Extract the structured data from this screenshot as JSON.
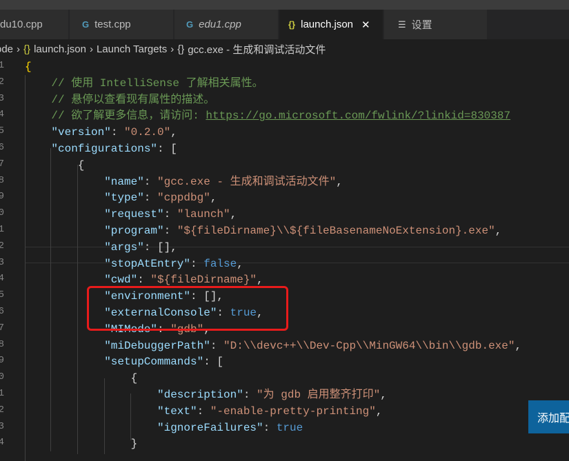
{
  "tabs": [
    {
      "label": "du10.cpp",
      "icon": "cpp-icon"
    },
    {
      "label": "test.cpp",
      "icon": "cpp-icon"
    },
    {
      "label": "edu1.cpp",
      "icon": "cpp-icon"
    },
    {
      "label": "launch.json",
      "icon": "json-icon",
      "active": true
    },
    {
      "label": "设置",
      "icon": "settings-icon"
    }
  ],
  "breadcrumb": [
    "ode",
    "launch.json",
    "Launch Targets",
    "gcc.exe - 生成和调试活动文件"
  ],
  "line_numbers": [
    "1",
    "2",
    "3",
    "4",
    "5",
    "6",
    "7",
    "8",
    "9",
    "0",
    "1",
    "2",
    "3",
    "4",
    "5",
    "6",
    "7",
    "8",
    "9",
    "0",
    "1",
    "2",
    "3",
    "4"
  ],
  "code": [
    [
      [
        0,
        "br",
        "{"
      ]
    ],
    [
      [
        1,
        "c",
        "// 使用 IntelliSense 了解相关属性。"
      ]
    ],
    [
      [
        1,
        "c",
        "// 悬停以查看现有属性的描述。"
      ]
    ],
    [
      [
        1,
        "c",
        "// 欲了解更多信息，请访问: "
      ],
      [
        1,
        "c u",
        "https://go.microsoft.com/fwlink/?linkid=830387"
      ]
    ],
    [
      [
        1,
        "k",
        "\"version\""
      ],
      [
        1,
        "p",
        ": "
      ],
      [
        1,
        "s",
        "\"0.2.0\""
      ],
      [
        1,
        "p",
        ","
      ]
    ],
    [
      [
        1,
        "k",
        "\"configurations\""
      ],
      [
        1,
        "p",
        ": ["
      ]
    ],
    [
      [
        2,
        "p",
        "{"
      ]
    ],
    [
      [
        3,
        "k",
        "\"name\""
      ],
      [
        3,
        "p",
        ": "
      ],
      [
        3,
        "s",
        "\"gcc.exe - 生成和调试活动文件\""
      ],
      [
        3,
        "p",
        ","
      ]
    ],
    [
      [
        3,
        "k",
        "\"type\""
      ],
      [
        3,
        "p",
        ": "
      ],
      [
        3,
        "s",
        "\"cppdbg\""
      ],
      [
        3,
        "p",
        ","
      ]
    ],
    [
      [
        3,
        "k",
        "\"request\""
      ],
      [
        3,
        "p",
        ": "
      ],
      [
        3,
        "s",
        "\"launch\""
      ],
      [
        3,
        "p",
        ","
      ]
    ],
    [
      [
        3,
        "k",
        "\"program\""
      ],
      [
        3,
        "p",
        ": "
      ],
      [
        3,
        "s",
        "\"${fileDirname}\\\\${fileBasenameNoExtension}.exe\""
      ],
      [
        3,
        "p",
        ","
      ]
    ],
    [
      [
        3,
        "k",
        "\"args\""
      ],
      [
        3,
        "p",
        ": [],"
      ]
    ],
    [
      [
        3,
        "k",
        "\"stopAtEntry\""
      ],
      [
        3,
        "p",
        ": "
      ],
      [
        3,
        "b",
        "false"
      ],
      [
        3,
        "p",
        ","
      ]
    ],
    [
      [
        3,
        "k",
        "\"cwd\""
      ],
      [
        3,
        "p",
        ": "
      ],
      [
        3,
        "s",
        "\"${fileDirname}\""
      ],
      [
        3,
        "p",
        ","
      ]
    ],
    [
      [
        3,
        "k",
        "\"environment\""
      ],
      [
        3,
        "p",
        ": [],"
      ]
    ],
    [
      [
        3,
        "k",
        "\"externalConsole\""
      ],
      [
        3,
        "p",
        ": "
      ],
      [
        3,
        "b",
        "true"
      ],
      [
        3,
        "p",
        ","
      ]
    ],
    [
      [
        3,
        "k",
        "\"MIMode\""
      ],
      [
        3,
        "p",
        ": "
      ],
      [
        3,
        "s",
        "\"gdb\""
      ],
      [
        3,
        "p",
        ","
      ]
    ],
    [
      [
        3,
        "k",
        "\"miDebuggerPath\""
      ],
      [
        3,
        "p",
        ": "
      ],
      [
        3,
        "s",
        "\"D:\\\\devc++\\\\Dev-Cpp\\\\MinGW64\\\\bin\\\\gdb.exe\""
      ],
      [
        3,
        "p",
        ","
      ]
    ],
    [
      [
        3,
        "k",
        "\"setupCommands\""
      ],
      [
        3,
        "p",
        ": ["
      ]
    ],
    [
      [
        4,
        "p",
        "{"
      ]
    ],
    [
      [
        5,
        "k",
        "\"description\""
      ],
      [
        5,
        "p",
        ": "
      ],
      [
        5,
        "s",
        "\"为 gdb 启用整齐打印\""
      ],
      [
        5,
        "p",
        ","
      ]
    ],
    [
      [
        5,
        "k",
        "\"text\""
      ],
      [
        5,
        "p",
        ": "
      ],
      [
        5,
        "s",
        "\"-enable-pretty-printing\""
      ],
      [
        5,
        "p",
        ","
      ]
    ],
    [
      [
        5,
        "k",
        "\"ignoreFailures\""
      ],
      [
        5,
        "p",
        ": "
      ],
      [
        5,
        "b",
        "true"
      ]
    ],
    [
      [
        4,
        "p",
        "}"
      ]
    ]
  ],
  "add_config_button": "添加配",
  "colors": {
    "background": "#1e1e1e",
    "key": "#9cdcfe",
    "string": "#ce9178",
    "comment": "#6a9955",
    "keyword": "#569cd6",
    "button": "#0e639c",
    "highlight_box": "#e81b1b"
  }
}
